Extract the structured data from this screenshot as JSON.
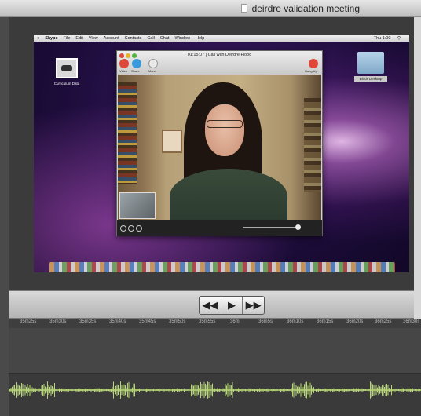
{
  "window": {
    "title": "deirdre validation meeting"
  },
  "screen": {
    "menubar": {
      "items": [
        "Skype",
        "File",
        "Edit",
        "View",
        "Account",
        "Contacts",
        "Call",
        "Chat",
        "Window",
        "Help"
      ],
      "status": "Thu 1:00"
    },
    "desktop_icon": {
      "label": "Curriculum Data"
    },
    "folder_icon": {
      "label": "Block Desktop"
    },
    "skype_call": {
      "title": "01:15:07 | Call with Deirdre Flood",
      "tools": {
        "video": "Video",
        "share": "Share",
        "more": "More",
        "hang_up": "Hang Up"
      }
    }
  },
  "transport": {
    "rewind": "◀◀",
    "play": "▶",
    "forward": "▶▶"
  },
  "timeline": {
    "ticks": [
      "35m25s",
      "35m30s",
      "35m35s",
      "35m40s",
      "35m45s",
      "35m50s",
      "35m55s",
      "36m",
      "36m5s",
      "36m10s",
      "36m15s",
      "36m20s",
      "36m25s",
      "36m30s"
    ]
  },
  "colors": {
    "waveform": "#b8d57a",
    "accent_red": "#e0463a"
  }
}
